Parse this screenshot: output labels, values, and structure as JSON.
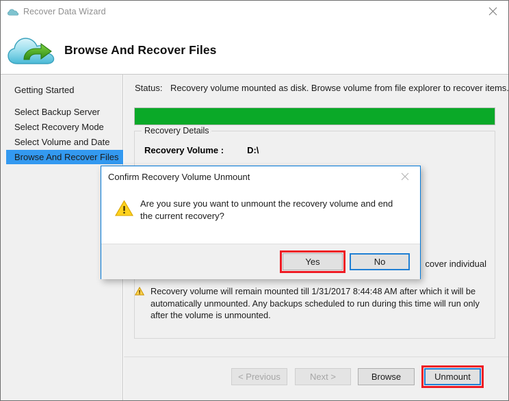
{
  "window": {
    "title": "Recover Data Wizard",
    "title_icon": "cloud-icon",
    "close_icon": "close-icon",
    "accent_blue": "#0078d7",
    "annotation_red": "#ee1b24"
  },
  "header": {
    "logo_icon": "cloud-recover-logo",
    "title": "Browse And Recover Files"
  },
  "sidebar": {
    "items": [
      {
        "label": "Getting Started",
        "selected": false
      },
      {
        "label": "Select Backup Server",
        "selected": false
      },
      {
        "label": "Select Recovery Mode",
        "selected": false
      },
      {
        "label": "Select Volume and Date",
        "selected": false
      },
      {
        "label": "Browse And Recover Files",
        "selected": true
      }
    ],
    "selected_color": "#3399f0"
  },
  "main": {
    "status_label": "Status:",
    "status_text": "Recovery volume mounted as disk. Browse volume from file explorer to recover items.",
    "progress": {
      "percent": 100,
      "color": "#0aa928"
    },
    "group": {
      "legend": "Recovery Details",
      "detail_key": "Recovery Volume :",
      "detail_value": "D:\\",
      "browse_hint": "cover individual"
    },
    "note": {
      "icon": "warning-icon",
      "text": "Recovery volume will remain mounted till 1/31/2017 8:44:48 AM after which it will be automatically unmounted. Any backups scheduled to run during this time will run only after the volume is unmounted."
    }
  },
  "footer": {
    "previous": "< Previous",
    "next": "Next >",
    "browse": "Browse",
    "unmount": "Unmount"
  },
  "dialog": {
    "title": "Confirm Recovery Volume Unmount",
    "close_icon": "close-icon",
    "warn_icon": "warning-triangle-icon",
    "message": "Are you sure you want to unmount the recovery volume and end the current recovery?",
    "yes": "Yes",
    "no": "No"
  }
}
